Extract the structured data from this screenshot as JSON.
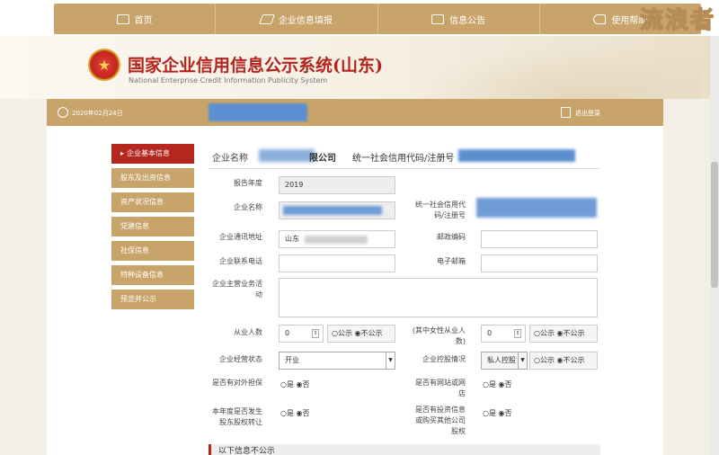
{
  "nav": {
    "items": [
      {
        "label": "首页",
        "icon": "home-icon"
      },
      {
        "label": "企业信息填报",
        "icon": "edit-icon"
      },
      {
        "label": "信息公告",
        "icon": "notice-icon"
      },
      {
        "label": "使用帮助",
        "icon": "speaker-icon"
      }
    ]
  },
  "watermark": "流浪者",
  "header": {
    "title_cn": "国家企业信用信息公示系统(山东)",
    "title_en": "National Enterprise Credit Information Publicity System"
  },
  "status": {
    "date": "2020年02月24日",
    "logout": "退出登录"
  },
  "sidebar": {
    "items": [
      {
        "label": "企业基本信息",
        "active": true
      },
      {
        "label": "股东及出资信息",
        "active": false
      },
      {
        "label": "资产状况信息",
        "active": false
      },
      {
        "label": "党建信息",
        "active": false
      },
      {
        "label": "社保信息",
        "active": false
      },
      {
        "label": "特种设备信息",
        "active": false
      },
      {
        "label": "预览并公示",
        "active": false
      }
    ]
  },
  "form_header": {
    "name_label": "企业名称",
    "company_suffix": "限公司",
    "credit_label": "统一社会信用代码/注册号"
  },
  "form": {
    "report_year_label": "报告年度",
    "report_year_value": "2019",
    "company_name_label": "企业名称",
    "credit_code_label": "统一社会信用代码/注册号",
    "address_label": "企业通讯地址",
    "address_value": "山东",
    "postal_label": "邮政编码",
    "phone_label": "企业联系电话",
    "email_label": "电子邮箱",
    "business_label": "企业主营业务活动",
    "employees_label": "从业人数",
    "employees_value": "0",
    "female_label": "(其中女性从业人数)",
    "female_value": "0",
    "public_option": "○公示",
    "private_option": "◉不公示",
    "status_label": "企业经营状态",
    "status_value": "开业",
    "holding_label": "企业控股情况",
    "holding_value": "私人控股",
    "guarantee_label": "是否有对外担保",
    "website_label": "是否有网站或网店",
    "equity_transfer_label": "本年度是否发生股东股权转让",
    "investment_label": "是否有投资信息或购买其他公司股权",
    "yes_option": "○是",
    "no_option": "◉否",
    "section_title": "以下信息不公示"
  },
  "colors": {
    "gold": "#c9a46a",
    "red": "#b5261e",
    "redact_blue": "#5b8fd0"
  }
}
